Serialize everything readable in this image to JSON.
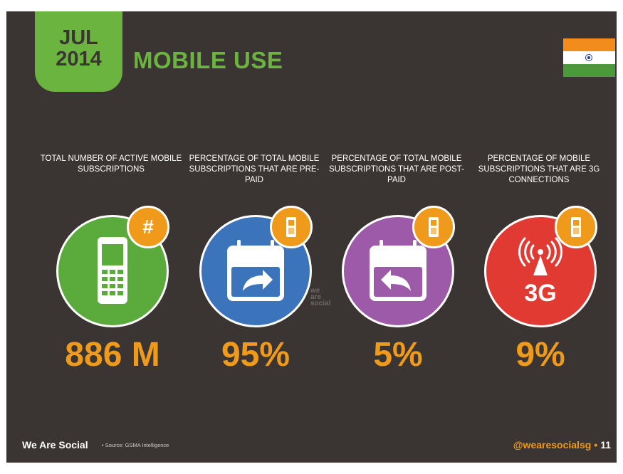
{
  "header": {
    "month": "JUL",
    "year": "2014",
    "title": "MOBILE USE"
  },
  "stats": [
    {
      "label": "TOTAL NUMBER OF ACTIVE MOBILE SUBSCRIPTIONS",
      "value": "886 M",
      "icon": "mobile-phone-icon",
      "badge": "#",
      "color": "#5aab3c"
    },
    {
      "label": "PERCENTAGE OF TOTAL MOBILE SUBSCRIPTIONS THAT ARE PRE-PAID",
      "value": "95%",
      "icon": "calendar-forward-arrow-icon",
      "badge": "phone-icon",
      "color": "#3c74bb"
    },
    {
      "label": "PERCENTAGE OF TOTAL MOBILE SUBSCRIPTIONS THAT ARE POST-PAID",
      "value": "5%",
      "icon": "calendar-back-arrow-icon",
      "badge": "phone-icon",
      "color": "#9c5aa8"
    },
    {
      "label": "PERCENTAGE OF MOBILE SUBSCRIPTIONS THAT ARE 3G CONNECTIONS",
      "value": "9%",
      "icon": "3g-tower-icon",
      "badge": "phone-icon",
      "color": "#e03a33",
      "icon_text": "3G"
    }
  ],
  "watermark": "we are social",
  "footer": {
    "brand": "We Are Social",
    "source": "• Source: GSMA Intelligence",
    "handle": "@wearesocialsg",
    "separator": "•",
    "page": "11"
  }
}
